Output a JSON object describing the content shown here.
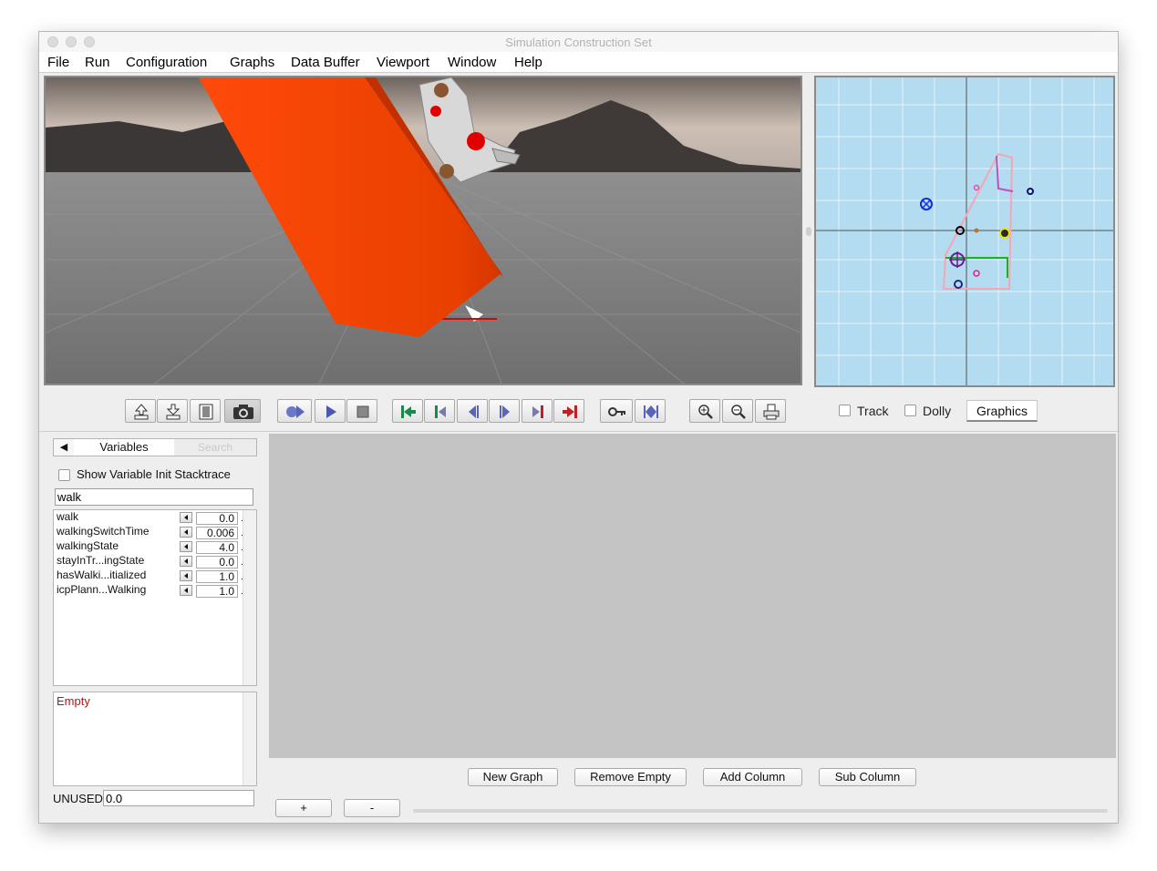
{
  "window": {
    "title": "Simulation Construction Set"
  },
  "menu": [
    "File",
    "Run",
    "Configuration",
    "Graphs",
    "Data Buffer",
    "Viewport",
    "Window",
    "Help"
  ],
  "toolbar": {
    "buttons": [
      "export-icon",
      "import-icon",
      "movie-icon",
      "camera-icon",
      "simulate-icon",
      "play-icon",
      "stop-icon",
      "goto-in-point-icon",
      "set-in-point-icon",
      "step-backward-icon",
      "step-forward-icon",
      "set-out-point-icon",
      "goto-out-point-icon",
      "key-icon",
      "toggle-keypoints-icon",
      "zoom-in-icon",
      "zoom-out-icon",
      "print-icon"
    ],
    "track_label": "Track",
    "dolly_label": "Dolly",
    "graphics_label": "Graphics",
    "track_checked": false,
    "dolly_checked": false
  },
  "variables_panel": {
    "tab_variables": "Variables",
    "tab_search": "Search",
    "show_stacktrace_label": "Show Variable Init Stacktrace",
    "search_value": "walk",
    "rows": [
      {
        "name": "walk",
        "value": "0.0"
      },
      {
        "name": "walkingSwitchTime",
        "value": "0.006"
      },
      {
        "name": "walkingState",
        "value": "4.0"
      },
      {
        "name": "stayInTr...ingState",
        "value": "0.0"
      },
      {
        "name": "hasWalki...itialized",
        "value": "1.0"
      },
      {
        "name": "icpPlann...Walking",
        "value": "1.0"
      }
    ],
    "empty_label": "Empty",
    "unused_label": "UNUSED",
    "unused_value": "0.0"
  },
  "graph_buttons": {
    "new_graph": "New Graph",
    "remove_empty": "Remove Empty",
    "add_column": "Add Column",
    "sub_column": "Sub Column",
    "plus": "+",
    "minus": "-"
  },
  "colors": {
    "overhead_background": "#b3dcf0",
    "support_polygon": "#f4a6b6",
    "graph_area": "#c3c3c3",
    "empty_text": "#c01010"
  }
}
